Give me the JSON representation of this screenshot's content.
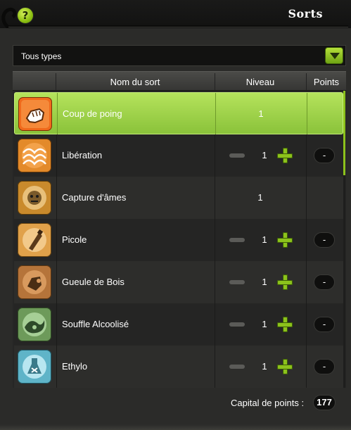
{
  "window": {
    "title": "Sorts",
    "help_label": "?"
  },
  "filter": {
    "selected": "Tous types"
  },
  "table": {
    "headers": {
      "name": "Nom du sort",
      "level": "Niveau",
      "points": "Points"
    },
    "rows": [
      {
        "name": "Coup de poing",
        "level": "1",
        "icon": "fist-icon",
        "controls": false,
        "points": "",
        "selected": true
      },
      {
        "name": "Libération",
        "level": "1",
        "icon": "waves-icon",
        "controls": true,
        "points": "-",
        "selected": false
      },
      {
        "name": "Capture d'âmes",
        "level": "1",
        "icon": "soul-capture-icon",
        "controls": false,
        "points": "",
        "selected": false
      },
      {
        "name": "Picole",
        "level": "1",
        "icon": "bottle-icon",
        "controls": true,
        "points": "-",
        "selected": false
      },
      {
        "name": "Gueule de Bois",
        "level": "1",
        "icon": "hangover-icon",
        "controls": true,
        "points": "-",
        "selected": false
      },
      {
        "name": "Souffle Alcoolisé",
        "level": "1",
        "icon": "breath-icon",
        "controls": true,
        "points": "-",
        "selected": false
      },
      {
        "name": "Ethylo",
        "level": "1",
        "icon": "potion-icon",
        "controls": true,
        "points": "-",
        "selected": false
      }
    ]
  },
  "footer": {
    "capital_label": "Capital de points :",
    "capital_value": "177"
  },
  "colors": {
    "accent": "#8cc21c",
    "selected_row": "#a6d64e",
    "background": "#2b2b29"
  }
}
